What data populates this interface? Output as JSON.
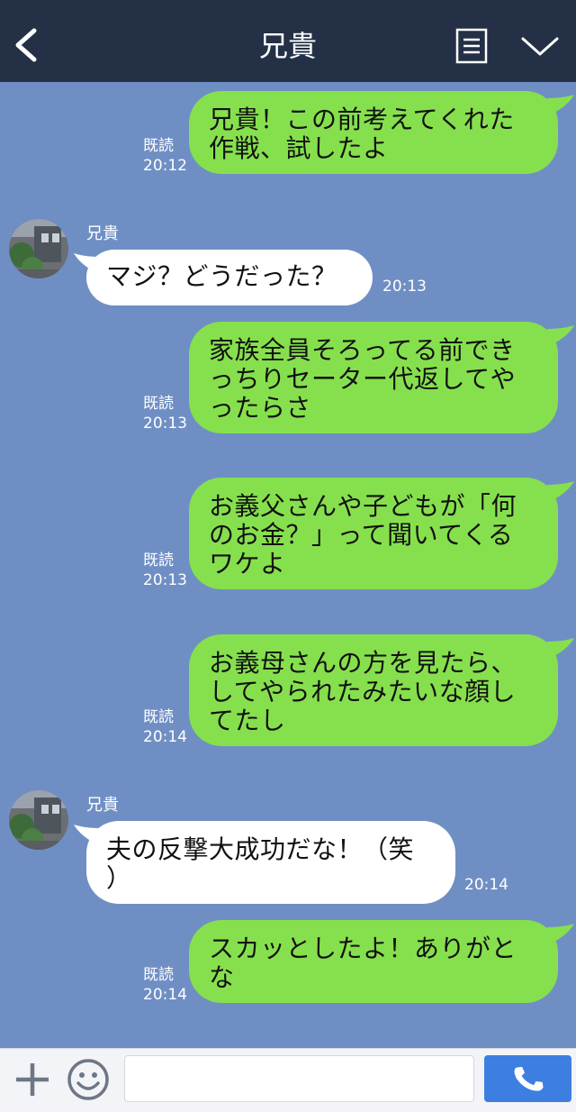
{
  "header": {
    "title": "兄貴",
    "icons": [
      "chevron-left-icon",
      "menu-list-icon",
      "chevron-down-icon"
    ]
  },
  "messages": [
    {
      "from": "me",
      "lines": [
        "兄貴！この前考えてくれた",
        "作戦、試したよ"
      ],
      "read_label": "既読",
      "time": "20:12"
    },
    {
      "from": "them",
      "sender": "兄貴",
      "lines": [
        "マジ？どうだった？"
      ],
      "time": "20:13"
    },
    {
      "from": "me",
      "lines": [
        "家族全員そろってる前でき",
        "っちりセーター代返してや",
        "ったらさ"
      ],
      "read_label": "既読",
      "time": "20:13"
    },
    {
      "from": "me",
      "lines": [
        "お義父さんや子どもが「何",
        "のお金？」って聞いてくる",
        "ワケよ"
      ],
      "read_label": "既読",
      "time": "20:13"
    },
    {
      "from": "me",
      "lines": [
        "お義母さんの方を見たら、",
        "してやられたみたいな顔し",
        "てたし"
      ],
      "read_label": "既読",
      "time": "20:14"
    },
    {
      "from": "them",
      "sender": "兄貴",
      "lines": [
        "夫の反撃大成功だな！（笑",
        "）"
      ],
      "time": "20:14"
    },
    {
      "from": "me",
      "lines": [
        "スカッとしたよ！ありがと",
        "な"
      ],
      "read_label": "既読",
      "time": "20:14"
    }
  ],
  "footer": {
    "input_value": "",
    "icons": [
      "plus-icon",
      "smile-icon",
      "phone-icon"
    ]
  },
  "colors": {
    "header_bg": "#243046",
    "chat_bg": "#6f8fc4",
    "my_bubble": "#86e04d",
    "their_bubble": "#ffffff",
    "call_button": "#3d7fe0"
  }
}
